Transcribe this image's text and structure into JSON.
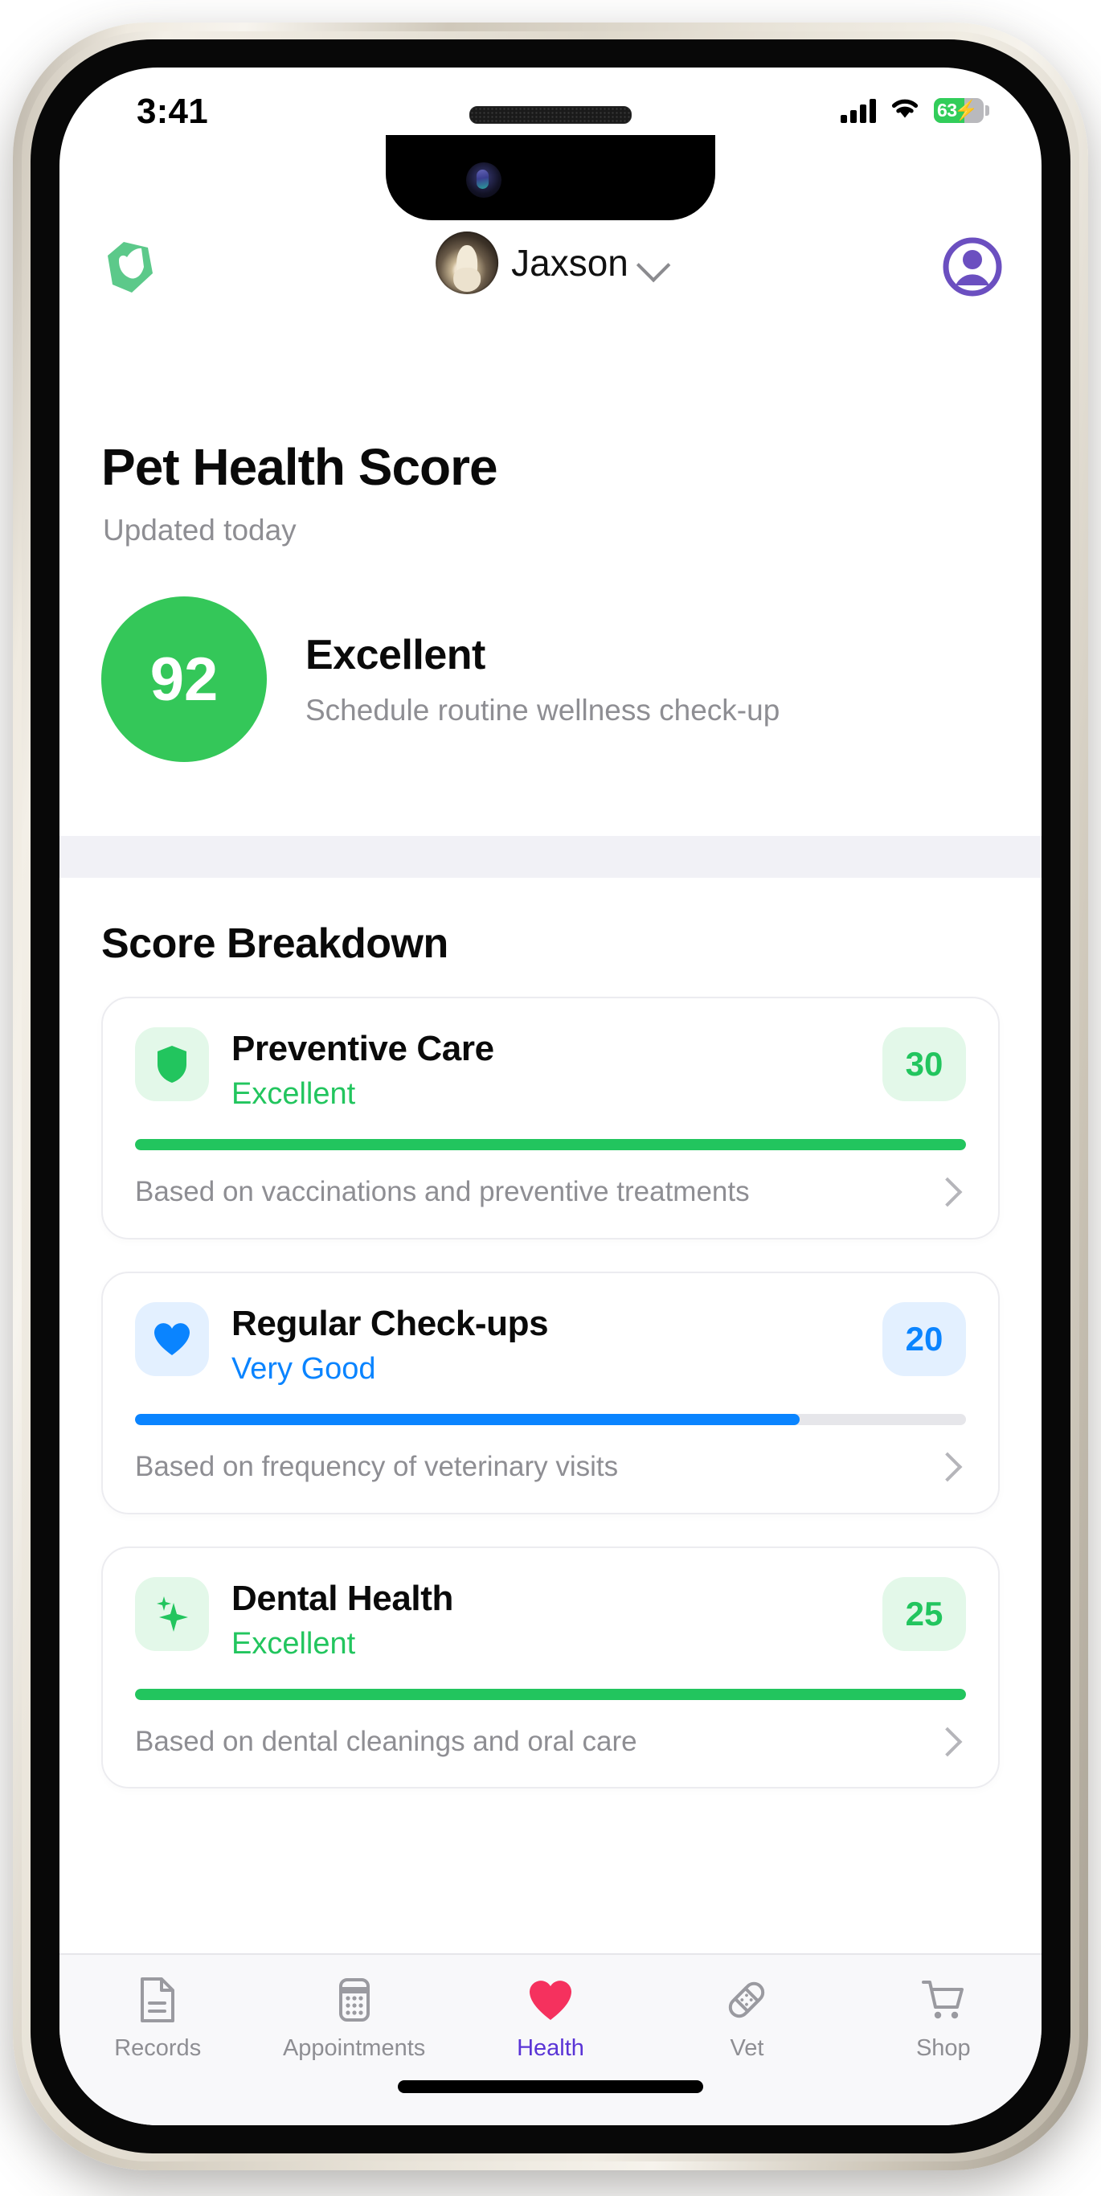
{
  "status_bar": {
    "time": "3:41",
    "signal_icon": "cellular-signal-icon",
    "wifi_icon": "wifi-icon",
    "battery_percent": "63",
    "battery_charging": true,
    "battery_icon": "battery-charging-icon"
  },
  "header": {
    "logo_icon": "pet-logo-icon",
    "pet_name": "Jaxson",
    "pet_avatar": "pet-avatar-image",
    "chevron_icon": "chevron-down-icon",
    "account_icon": "account-circle-icon"
  },
  "hero": {
    "title": "Pet Health Score",
    "subtitle": "Updated today",
    "score": "92",
    "rating": "Excellent",
    "advice": "Schedule routine wellness check-up",
    "score_color": "#34c759"
  },
  "breakdown": {
    "section_title": "Score Breakdown",
    "cards": [
      {
        "icon": "shield-icon",
        "title": "Preventive Care",
        "rating": "Excellent",
        "score": "30",
        "progress_percent": 100,
        "description": "Based on vaccinations and preventive treatments",
        "accent": "#22c55e",
        "tint": "#e3f8e9",
        "chevron_icon": "chevron-right-icon"
      },
      {
        "icon": "heart-icon",
        "title": "Regular Check-ups",
        "rating": "Very Good",
        "score": "20",
        "progress_percent": 80,
        "description": "Based on frequency of veterinary visits",
        "accent": "#0a84ff",
        "tint": "#e3f0ff",
        "chevron_icon": "chevron-right-icon"
      },
      {
        "icon": "sparkle-icon",
        "title": "Dental Health",
        "rating": "Excellent",
        "score": "25",
        "progress_percent": 100,
        "description": "Based on dental cleanings and oral care",
        "accent": "#22c55e",
        "tint": "#e3f8e9",
        "chevron_icon": "chevron-right-icon"
      }
    ]
  },
  "tabbar": {
    "active_color": "#5a34d6",
    "items": [
      {
        "label": "Records",
        "icon": "document-icon",
        "active": false
      },
      {
        "label": "Appointments",
        "icon": "calendar-icon",
        "active": false
      },
      {
        "label": "Health",
        "icon": "heart-icon",
        "active": true
      },
      {
        "label": "Vet",
        "icon": "bandage-icon",
        "active": false
      },
      {
        "label": "Shop",
        "icon": "shopping-cart-icon",
        "active": false
      }
    ]
  }
}
